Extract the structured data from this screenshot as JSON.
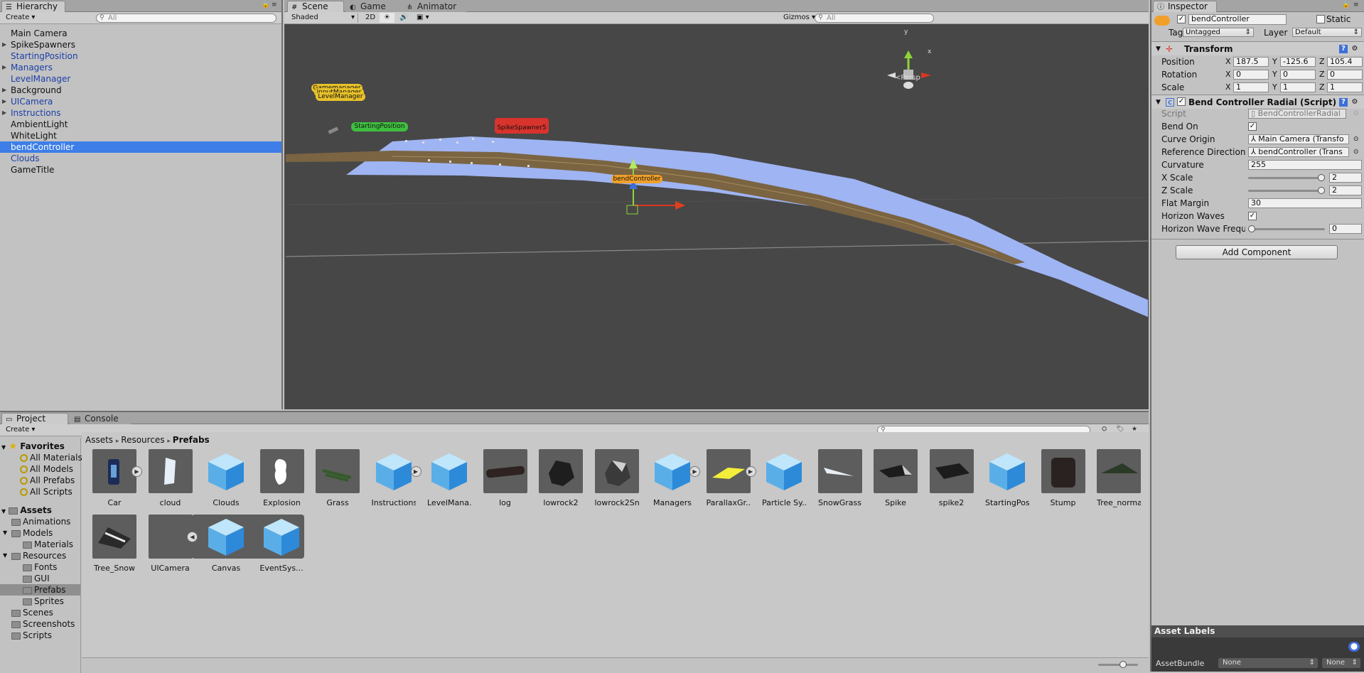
{
  "hierarchy": {
    "tab": "Hierarchy",
    "create": "Create",
    "search_placeholder": "All",
    "items": [
      {
        "label": "Main Camera"
      },
      {
        "label": "SpikeSpawners"
      },
      {
        "label": "StartingPosition"
      },
      {
        "label": "Managers"
      },
      {
        "label": "LevelManager"
      },
      {
        "label": "Background"
      },
      {
        "label": "UICamera"
      },
      {
        "label": "Instructions"
      },
      {
        "label": "AmbientLight"
      },
      {
        "label": "WhiteLight"
      },
      {
        "label": "bendController"
      },
      {
        "label": "Clouds"
      },
      {
        "label": "GameTitle"
      }
    ]
  },
  "scene": {
    "tabs": [
      "Scene",
      "Game",
      "Animator"
    ],
    "shading": "Shaded",
    "mode_2d": "2D",
    "gizmos": "Gizmos",
    "search_placeholder": "All",
    "persp": "Persp",
    "gizmo_axis_y": "y",
    "gizmo_axis_x": "x",
    "labels": {
      "gamemanager": "Gamemanager",
      "inputmanager": "InputManager",
      "levelmanager": "LevelManager",
      "starting": "StartingPosition",
      "spike": "SpikeSpawner5",
      "bend": "bendController"
    }
  },
  "inspector": {
    "tab": "Inspector",
    "object_name": "bendController",
    "static_label": "Static",
    "tag_label": "Tag",
    "tag_value": "Untagged",
    "layer_label": "Layer",
    "layer_value": "Default",
    "transform": {
      "title": "Transform",
      "position_label": "Position",
      "rotation_label": "Rotation",
      "scale_label": "Scale",
      "x": "X",
      "y": "Y",
      "z": "Z",
      "position": [
        "187.5",
        "-125.6",
        "105.4"
      ],
      "rotation": [
        "0",
        "0",
        "0"
      ],
      "scale": [
        "1",
        "1",
        "1"
      ]
    },
    "script_comp": {
      "title": "Bend Controller Radial (Script)",
      "script_label": "Script",
      "script_value": "BendControllerRadial",
      "bend_on_label": "Bend On",
      "curve_origin_label": "Curve Origin",
      "curve_origin_value": "Main Camera (Transfo",
      "ref_dir_label": "Reference Direction",
      "ref_dir_value": "bendController (Trans",
      "curvature_label": "Curvature",
      "curvature_value": "255",
      "xscale_label": "X Scale",
      "xscale_value": "2",
      "xscale_level": 1.0,
      "zscale_label": "Z Scale",
      "zscale_value": "2",
      "zscale_level": 1.0,
      "flat_margin_label": "Flat Margin",
      "flat_margin_value": "30",
      "horizon_waves_label": "Horizon Waves",
      "horizon_freq_label": "Horizon Wave Frequ",
      "horizon_freq_value": "0",
      "horizon_freq_level": 0.0
    },
    "add_component": "Add Component",
    "asset_labels": "Asset Labels",
    "asset_bundle_label": "AssetBundle",
    "asset_bundle_value": "None",
    "asset_bundle_variant": "None"
  },
  "project": {
    "tabs": [
      "Project",
      "Console"
    ],
    "create": "Create",
    "favorites": "Favorites",
    "favorite_items": [
      "All Materials",
      "All Models",
      "All Prefabs",
      "All Scripts"
    ],
    "assets": "Assets",
    "tree": [
      {
        "label": "Animations",
        "depth": 1
      },
      {
        "label": "Models",
        "depth": 1
      },
      {
        "label": "Materials",
        "depth": 2
      },
      {
        "label": "Resources",
        "depth": 1
      },
      {
        "label": "Fonts",
        "depth": 2
      },
      {
        "label": "GUI",
        "depth": 2
      },
      {
        "label": "Prefabs",
        "depth": 2
      },
      {
        "label": "Sprites",
        "depth": 2
      },
      {
        "label": "Scenes",
        "depth": 1
      },
      {
        "label": "Screenshots",
        "depth": 1
      },
      {
        "label": "Scripts",
        "depth": 1
      }
    ],
    "breadcrumb": [
      "Assets",
      "Resources",
      "Prefabs"
    ],
    "assets_row1": [
      "Car",
      "cloud",
      "Clouds",
      "Explosion",
      "Grass",
      "Instructions",
      "LevelMana...",
      "log",
      "lowrock2",
      "lowrock2Sn...",
      "Managers",
      "ParallaxGr...",
      "Particle Sy...",
      "SnowGrass",
      "Spike",
      "spike2",
      "StartingPos...",
      "Stump",
      "Tree_normal"
    ],
    "assets_row2": [
      "Tree_Snow",
      "UICamera",
      "Canvas",
      "EventSys..."
    ]
  }
}
